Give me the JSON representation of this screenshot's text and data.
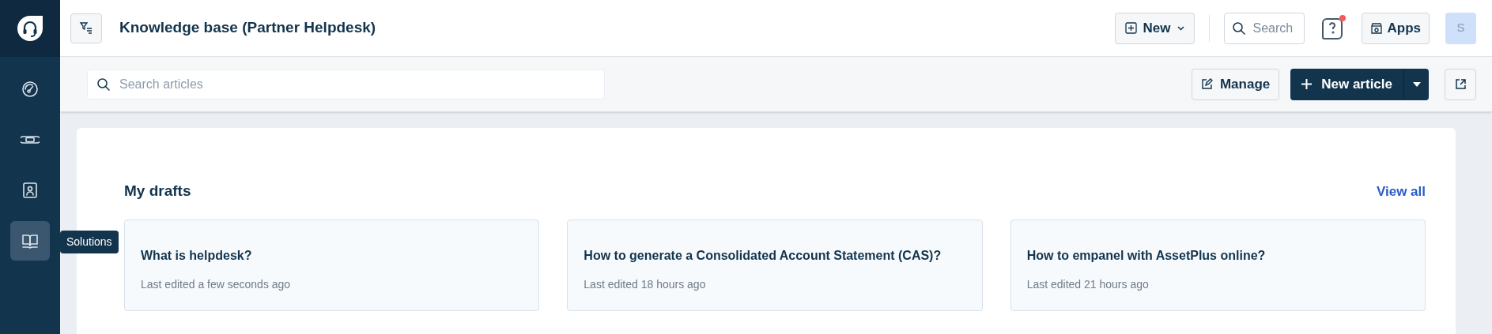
{
  "sidebar": {
    "items": [
      {
        "kind": "gauge",
        "selected": false
      },
      {
        "kind": "ticket",
        "selected": false
      },
      {
        "kind": "contact",
        "selected": false
      },
      {
        "kind": "book",
        "selected": true
      }
    ],
    "tooltip": "Solutions"
  },
  "header": {
    "title": "Knowledge base (Partner Helpdesk)",
    "new_button": "New",
    "search": {
      "placeholder": "Search"
    },
    "help_notification": true,
    "apps_button": "Apps",
    "avatar": "S"
  },
  "toolbar": {
    "search": {
      "placeholder": "Search articles"
    },
    "manage_button": "Manage",
    "new_article_button": "New article"
  },
  "drafts": {
    "title": "My drafts",
    "view_all": "View all",
    "cards": [
      {
        "title": "What is helpdesk?",
        "meta": "Last edited a few seconds ago"
      },
      {
        "title": "How to generate a Consolidated Account Statement (CAS)?",
        "meta": "Last edited 18 hours ago"
      },
      {
        "title": "How to empanel with AssetPlus online?",
        "meta": "Last edited 21 hours ago"
      }
    ]
  }
}
